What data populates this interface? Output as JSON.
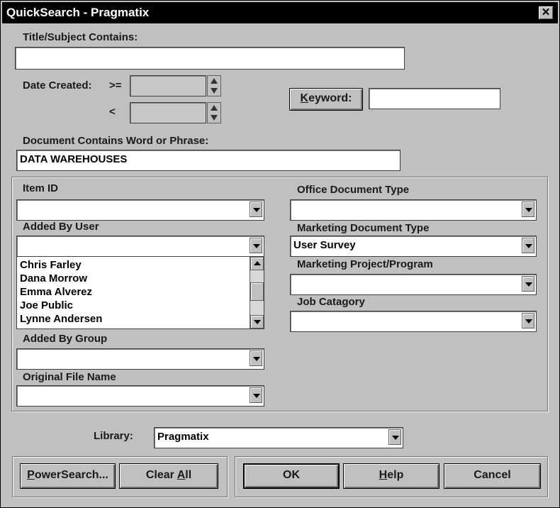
{
  "window": {
    "title": "QuickSearch - Pragmatix",
    "close_glyph": "✕"
  },
  "title_subject": {
    "label": "Title/Subject Contains:",
    "value": ""
  },
  "date_created": {
    "label": "Date Created:",
    "op_ge": ">=",
    "op_lt": "<",
    "from_value": "",
    "to_value": ""
  },
  "keyword": {
    "label_prefix": "K",
    "label_rest": "eyword:",
    "value": ""
  },
  "doc_contains": {
    "label": "Document Contains Word or Phrase:",
    "value": "DATA WAREHOUSES"
  },
  "item_id": {
    "label": "Item ID",
    "value": ""
  },
  "added_by_user": {
    "label": "Added By User",
    "value": "",
    "options": [
      "Chris Farley",
      "Dana Morrow",
      "Emma Alverez",
      "Joe Public",
      "Lynne Andersen"
    ]
  },
  "added_by_group": {
    "label": "Added By Group",
    "value": ""
  },
  "original_file_name": {
    "label": "Original File Name",
    "value": ""
  },
  "office_doc_type": {
    "label": "Office Document Type",
    "value": ""
  },
  "marketing_doc_type": {
    "label": "Marketing Document Type",
    "value": "User Survey"
  },
  "marketing_project": {
    "label": "Marketing Project/Program",
    "value": ""
  },
  "job_category": {
    "label": "Job Catagory",
    "value": ""
  },
  "library": {
    "label": "Library:",
    "value": "Pragmatix"
  },
  "buttons": {
    "powersearch_prefix": "P",
    "powersearch_rest": "owerSearch...",
    "clear_all_prefix": "Clear ",
    "clear_all_ul": "A",
    "clear_all_rest": "ll",
    "ok": "OK",
    "help_prefix": "H",
    "help_rest": "elp",
    "cancel": "Cancel"
  }
}
